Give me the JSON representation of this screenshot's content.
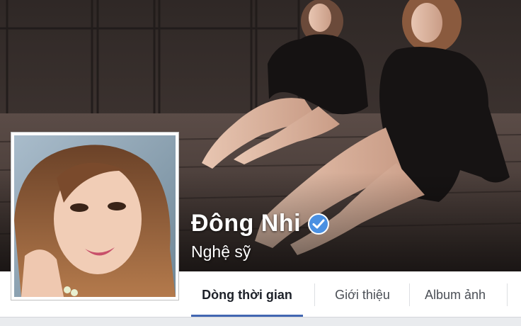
{
  "profile": {
    "name": "Đông Nhi",
    "category": "Nghệ sỹ",
    "verified_icon": "verified-check-icon"
  },
  "tabs": [
    {
      "label": "Dòng thời gian",
      "active": true
    },
    {
      "label": "Giới thiệu",
      "active": false
    },
    {
      "label": "Album ảnh",
      "active": false
    }
  ],
  "colors": {
    "accent": "#4267b2",
    "verified": "#4a90e2",
    "tab_bar": "#ffffff",
    "page_bg": "#e9ebee"
  }
}
